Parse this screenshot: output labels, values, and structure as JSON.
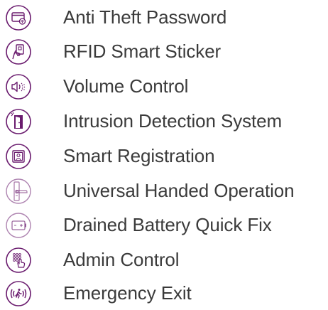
{
  "accent_color": "#6a1b6e",
  "text_color": "#3b3b3b",
  "features": [
    {
      "label": "Anti Theft Password",
      "icon": "card-password-icon"
    },
    {
      "label": "RFID Smart Sticker",
      "icon": "rfid-sticker-icon"
    },
    {
      "label": "Volume Control",
      "icon": "volume-icon"
    },
    {
      "label": "Intrusion Detection System",
      "icon": "intrusion-door-icon"
    },
    {
      "label": "Smart Registration",
      "icon": "registration-id-icon"
    },
    {
      "label": "Universal Handed Operation",
      "icon": "door-handle-icon"
    },
    {
      "label": "Drained Battery Quick Fix",
      "icon": "battery-icon"
    },
    {
      "label": "Admin Control",
      "icon": "keypad-touch-icon"
    },
    {
      "label": "Emergency Exit",
      "icon": "emergency-exit-icon"
    }
  ]
}
